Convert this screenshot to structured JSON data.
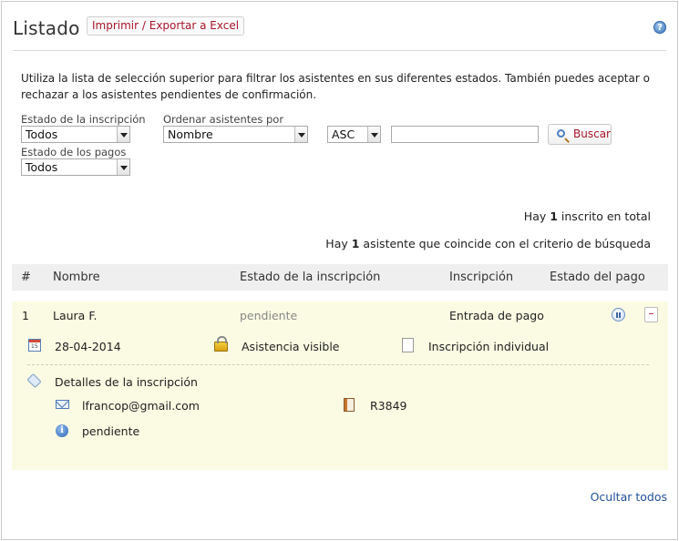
{
  "header": {
    "title": "Listado",
    "export_label": "Imprimir / Exportar a Excel",
    "help_glyph": "?"
  },
  "intro_text": "Utiliza la lista de selección superior para filtrar los asistentes en sus diferentes estados. También puedes aceptar o rechazar a los asistentes pendientes de confirmación.",
  "filters": {
    "registration_status_label": "Estado de la inscripción",
    "registration_status_value": "Todos",
    "payment_status_label": "Estado de los pagos",
    "payment_status_value": "Todos",
    "order_by_label": "Ordenar asistentes por",
    "order_by_value": "Nombre",
    "order_dir_value": "ASC",
    "search_value": "",
    "search_button": "Buscar"
  },
  "summary": {
    "total_prefix": "Hay ",
    "total_count": "1",
    "total_suffix": " inscrito en total",
    "match_prefix": "Hay ",
    "match_count": "1",
    "match_suffix": " asistente que coincide con el criterio de búsqueda"
  },
  "table": {
    "headers": [
      "#",
      "Nombre",
      "Estado de la inscripción",
      "Inscripción",
      "Estado del pago"
    ],
    "rows": [
      {
        "index": "1",
        "name": "Laura F.",
        "status": "pendiente",
        "ticket": "Entrada de pago",
        "collapse_glyph": "–",
        "date": "28-04-2014",
        "visibility": "Asistencia visible",
        "registration_type": "Inscripción individual",
        "details_title": "Detalles de la inscripción",
        "email": "lfrancop@gmail.com",
        "reference": "R3849",
        "detail_status": "pendiente"
      }
    ]
  },
  "footer": {
    "hide_all": "Ocultar todos"
  },
  "colors": {
    "accent_red": "#a8162b",
    "link_blue": "#1f4f9a",
    "row_highlight": "#fbfbe3",
    "header_bg": "#efefef"
  }
}
